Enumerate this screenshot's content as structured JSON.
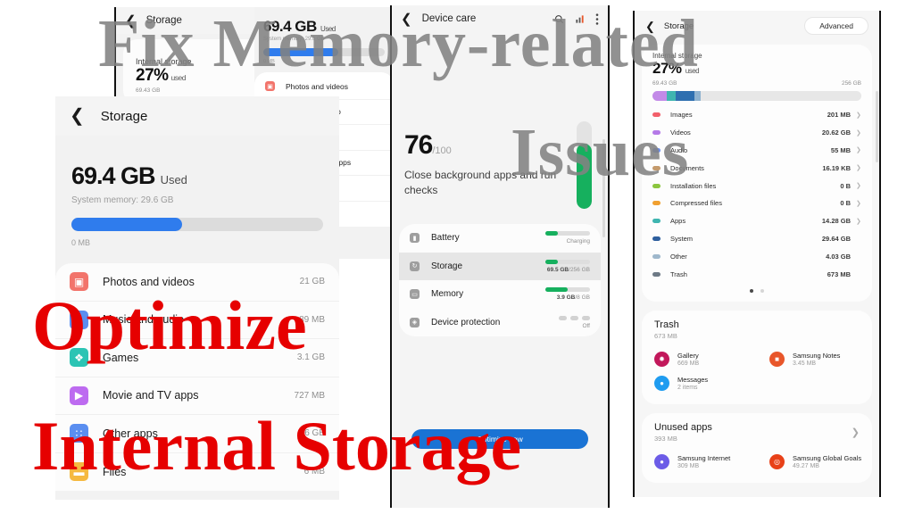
{
  "overlay": {
    "line1": "Fix Memory-related",
    "line2": "Issues",
    "line3": "Optimize",
    "line4": "Internal Storage",
    "gray_color": "#828282",
    "red_color": "#e60000"
  },
  "panel_back_storage": {
    "title": "Storage",
    "back_icon": "chevron-left-icon",
    "heading": "Internal storage",
    "percent": "27%",
    "percent_suffix": "used",
    "used_label": "69.43 GB"
  },
  "panel_menu": {
    "used_value": "69.4 GB",
    "used_suffix": "Used",
    "system_memory": "System memory: 29.6 GB",
    "bar_min_label": "0 MB",
    "bar_fill_percent": 62,
    "items": [
      {
        "label": "Photos and videos",
        "icon": "photos-icon",
        "color": "#f2746b"
      },
      {
        "label": "Music and audio",
        "icon": "music-icon",
        "color": "#5a8ef0"
      },
      {
        "label": "Games",
        "icon": "games-icon",
        "color": "#2bc4b4"
      },
      {
        "label": "Movie and TV apps",
        "icon": "movie-icon",
        "color": "#bd6bf0"
      },
      {
        "label": "Other apps",
        "icon": "grid-icon",
        "color": "#5a8ef0"
      },
      {
        "label": "Files",
        "icon": "folder-icon",
        "color": "#f5b940"
      }
    ]
  },
  "panel_storage": {
    "title": "Storage",
    "back_icon": "chevron-left-icon",
    "used_value": "69.4 GB",
    "used_suffix": "Used",
    "system_memory": "System memory: 29.6 GB",
    "bar_min_label": "0 MB",
    "bar_fill_percent": 44,
    "rows": [
      {
        "label": "Photos and videos",
        "size": "21 GB",
        "icon": "photos-icon",
        "color": "#f2746b"
      },
      {
        "label": "Music and audio",
        "size": "89 MB",
        "icon": "music-icon",
        "color": "#5a8ef0"
      },
      {
        "label": "Games",
        "size": "3.1 GB",
        "icon": "games-icon",
        "color": "#2bc4b4"
      },
      {
        "label": "Movie and TV apps",
        "size": "727 MB",
        "icon": "movie-icon",
        "color": "#bd6bf0"
      },
      {
        "label": "Other apps",
        "size": "16 GB",
        "icon": "grid-icon",
        "color": "#5a8ef0"
      },
      {
        "label": "Files",
        "size": "6 MB",
        "icon": "folder-icon",
        "color": "#f5b940"
      }
    ]
  },
  "panel_device_care": {
    "title": "Device care",
    "back_icon": "chevron-left-icon",
    "search_icon": "search-icon",
    "chart_icon": "bar-chart-icon",
    "menu_icon": "more-vertical-icon",
    "score": "76",
    "score_max": "/100",
    "score_text": "Close background apps and run checks",
    "tube_fill_percent": 75,
    "rows": [
      {
        "label": "Battery",
        "icon": "battery-icon",
        "status": "Charging",
        "bar_percent": 28,
        "selected": false
      },
      {
        "label": "Storage",
        "icon": "storage-icon",
        "value": "69.5 GB",
        "total": "/256 GB",
        "bar_percent": 27,
        "selected": true
      },
      {
        "label": "Memory",
        "icon": "memory-icon",
        "value": "3.9 GB",
        "total": "/8 GB",
        "bar_percent": 49,
        "selected": false
      },
      {
        "label": "Device protection",
        "icon": "shield-icon",
        "status": "Off",
        "dots": true,
        "selected": false
      }
    ],
    "optimize_button": "Optimize now"
  },
  "panel_storage_advanced": {
    "title": "Storage",
    "back_icon": "chevron-left-icon",
    "advanced_button": "Advanced",
    "heading": "Internal storage",
    "percent": "27%",
    "percent_suffix": "used",
    "used_label": "69.43 GB",
    "total_label": "256 GB",
    "segments": [
      {
        "color": "#c38ae8",
        "width": 7
      },
      {
        "color": "#3fb5b0",
        "width": 4
      },
      {
        "color": "#2e6fb0",
        "width": 9
      },
      {
        "color": "#8fb2cf",
        "width": 3
      }
    ],
    "categories": [
      {
        "label": "Images",
        "size": "201 MB",
        "color": "#f2606b",
        "chevron": true
      },
      {
        "label": "Videos",
        "size": "20.62 GB",
        "color": "#b57ae8",
        "chevron": true
      },
      {
        "label": "Audio",
        "size": "55 MB",
        "color": "#6b8ef0",
        "chevron": true
      },
      {
        "label": "Documents",
        "size": "16.19 KB",
        "color": "#c49a6c",
        "chevron": true
      },
      {
        "label": "Installation files",
        "size": "0 B",
        "color": "#8cc63f",
        "chevron": true
      },
      {
        "label": "Compressed files",
        "size": "0 B",
        "color": "#f0a030",
        "chevron": true
      },
      {
        "label": "Apps",
        "size": "14.28 GB",
        "color": "#3fb5b0",
        "chevron": true
      },
      {
        "label": "System",
        "size": "29.64 GB",
        "color": "#2e5f9e",
        "chevron": false
      },
      {
        "label": "Other",
        "size": "4.03 GB",
        "color": "#9fb8cc",
        "chevron": false
      },
      {
        "label": "Trash",
        "size": "673 MB",
        "color": "#6e7a86",
        "chevron": false
      }
    ],
    "pager_active": 0,
    "pager_count": 2,
    "trash": {
      "title": "Trash",
      "size": "673 MB",
      "apps": [
        {
          "name": "Gallery",
          "meta": "669 MB",
          "icon": "gallery-icon",
          "color": "#c2185b"
        },
        {
          "name": "Samsung Notes",
          "meta": "3.45 MB",
          "icon": "notes-icon",
          "color": "#e8562a"
        },
        {
          "name": "Messages",
          "meta": "2 items",
          "icon": "messages-icon",
          "color": "#1f9cf0"
        }
      ]
    },
    "unused": {
      "title": "Unused apps",
      "size": "393 MB",
      "chevron_icon": "chevron-right-icon",
      "apps": [
        {
          "name": "Samsung Internet",
          "meta": "309 MB",
          "icon": "internet-icon",
          "color": "#6c5ce7"
        },
        {
          "name": "Samsung Global Goals",
          "meta": "49.27 MB",
          "icon": "globalgoals-icon",
          "color": "#e84118"
        }
      ]
    }
  }
}
